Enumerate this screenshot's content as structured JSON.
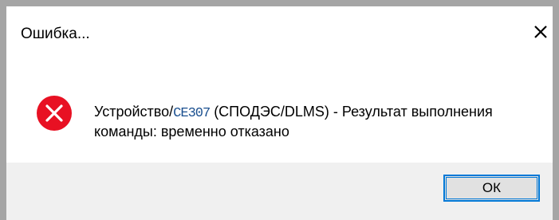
{
  "dialog": {
    "title": "Ошибка...",
    "close_icon": "close-icon",
    "error_icon": "error-icon",
    "message": {
      "prefix": "Устройство/",
      "device_model": "CE307",
      "suffix": " (СПОДЭС/DLMS) - Результат выполнения команды: временно отказано"
    },
    "ok_label": "ОК"
  },
  "colors": {
    "window_border": "#a5a5a5",
    "footer_bg": "#f0f0f0",
    "error_red": "#e81123",
    "button_focus": "#0078d7",
    "button_bg": "#e1e1e1"
  }
}
